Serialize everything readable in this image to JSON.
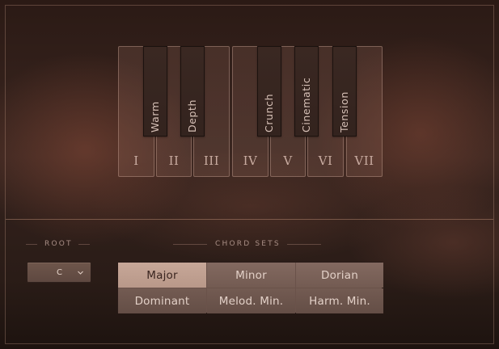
{
  "keyboard": {
    "white_keys": [
      "I",
      "II",
      "III",
      "IV",
      "V",
      "VI",
      "VII"
    ],
    "black_keys": [
      "Warm",
      "Depth",
      "Crunch",
      "Cinematic",
      "Tension"
    ]
  },
  "root": {
    "label": "ROOT",
    "value": "C"
  },
  "chord_sets": {
    "label": "CHORD SETS",
    "options": [
      "Major",
      "Minor",
      "Dorian",
      "Dominant",
      "Melod. Min.",
      "Harm. Min."
    ],
    "selected": "Major"
  },
  "colors": {
    "selected_button": "#c7a798",
    "button": "#7b625a",
    "background": "#2f1f1a"
  }
}
